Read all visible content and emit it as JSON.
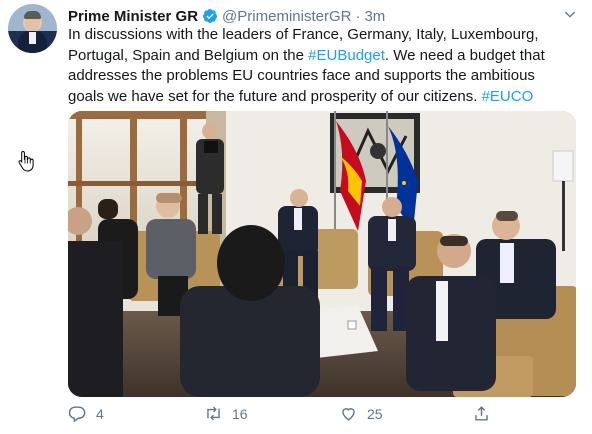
{
  "tweet": {
    "author_name": "Prime Minister GR",
    "author_handle": "@PrimeministerGR",
    "separator": "·",
    "time": "3m",
    "text_parts": [
      "In discussions with the leaders of France, Germany, Italy, Luxembourg, Portugal, Spain and Belgium on the ",
      "#EUBudget",
      ". We need a budget that addresses the problems EU countries face and supports the ambitious goals we have set for the future and prosperity of our citizens. ",
      "#EUCO"
    ]
  },
  "actions": {
    "reply_count": "4",
    "retweet_count": "16",
    "like_count": "25"
  },
  "colors": {
    "link": "#1da1f2",
    "muted": "#657786",
    "text": "#14171a"
  },
  "icons": [
    "verified-badge-icon",
    "chevron-down-icon",
    "reply-icon",
    "retweet-icon",
    "like-icon",
    "share-icon",
    "hand-cursor-icon"
  ]
}
